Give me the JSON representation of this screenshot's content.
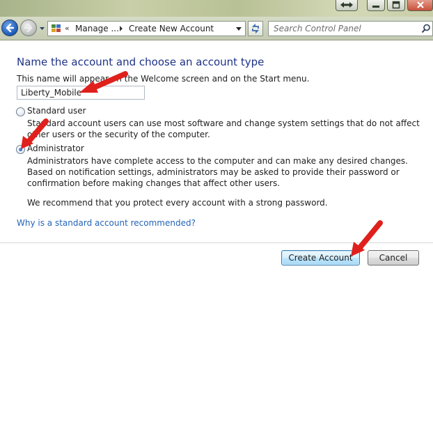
{
  "window": {
    "search_placeholder": "Search Control Panel"
  },
  "address_bar": {
    "overflow_chevron": "«",
    "crumbs": [
      "Manage ...",
      "Create New Account"
    ]
  },
  "content": {
    "heading": "Name the account and choose an account type",
    "name_hint": "This name will appear on the Welcome screen and on the Start menu.",
    "account_name_value": "Liberty_Mobile",
    "options": [
      {
        "label": "Standard user",
        "description": "Standard account users can use most software and change system settings that do not affect other users or the security of the computer.",
        "selected": false
      },
      {
        "label": "Administrator",
        "description": "Administrators have complete access to the computer and can make any desired changes. Based on notification settings, administrators may be asked to provide their password or confirmation before making changes that affect other users.",
        "selected": true
      }
    ],
    "recommendation": "We recommend that you protect every account with a strong password.",
    "help_link": "Why is a standard account recommended?"
  },
  "buttons": {
    "create": "Create Account",
    "cancel": "Cancel"
  },
  "colors": {
    "heading": "#1e3287",
    "link": "#2464b8",
    "annotation_arrow": "#e0201c"
  }
}
